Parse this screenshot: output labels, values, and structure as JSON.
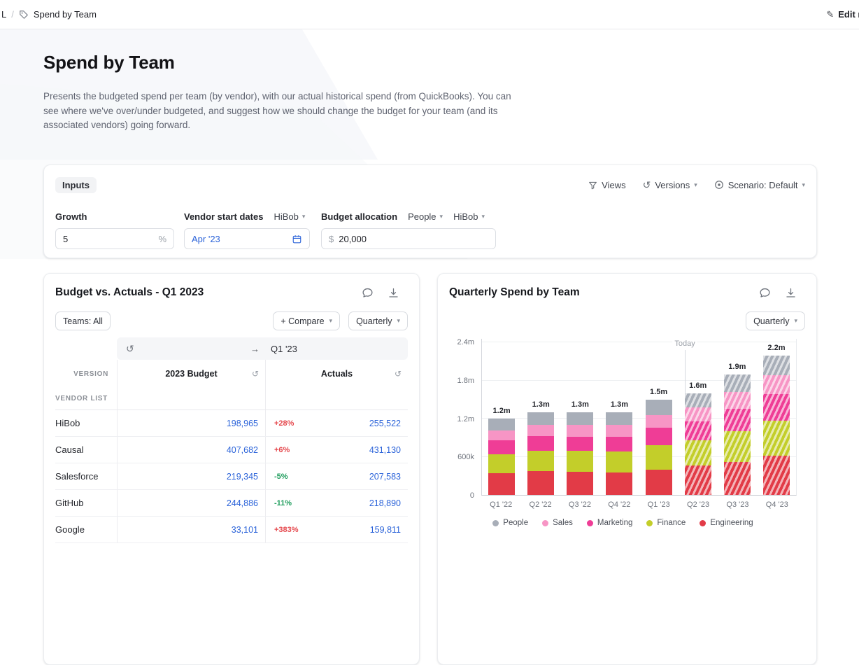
{
  "glyphs": {
    "caret": "▾",
    "history": "↺",
    "pencil": "✎"
  },
  "colors": {
    "accent_blue": "#2b63d9",
    "delta_up": "#e5484d",
    "delta_down": "#1f9d5d"
  },
  "topbar": {
    "crumb_truncated": "L",
    "separator": "/",
    "page_crumb": "Spend by Team",
    "edit_label": "Edit m"
  },
  "header": {
    "title": "Spend by Team",
    "description": "Presents the budgeted spend per team (by vendor), with our actual historical spend (from QuickBooks). You can see where we've over/under budgeted, and suggest how we should change the budget for your team (and its associated vendors) going forward."
  },
  "inputs_card": {
    "tab_label": "Inputs",
    "toolbar": {
      "views": "Views",
      "versions": "Versions",
      "scenario": "Scenario: Default"
    },
    "growth": {
      "label": "Growth",
      "value": "5",
      "suffix": "%"
    },
    "vendor_start_dates": {
      "label": "Vendor start dates",
      "selector": "HiBob",
      "value": "Apr '23"
    },
    "budget_allocation": {
      "label": "Budget allocation",
      "selector_team": "People",
      "selector_vendor": "HiBob",
      "prefix": "$",
      "value": "20,000"
    }
  },
  "left_card": {
    "title": "Budget vs. Actuals - Q1 2023",
    "teams_filter": "Teams: All",
    "compare_label": "+ Compare",
    "period_label": "Quarterly",
    "table": {
      "period_nav": {
        "arrow": "→",
        "period": "Q1 '23"
      },
      "version_label": "VERSION",
      "col_budget": "2023 Budget",
      "col_actuals": "Actuals",
      "group_label": "VENDOR LIST",
      "rows": [
        {
          "vendor": "HiBob",
          "budget": "198,965",
          "delta": "+28%",
          "actuals": "255,522"
        },
        {
          "vendor": "Causal",
          "budget": "407,682",
          "delta": "+6%",
          "actuals": "431,130"
        },
        {
          "vendor": "Salesforce",
          "budget": "219,345",
          "delta": "-5%",
          "actuals": "207,583"
        },
        {
          "vendor": "GitHub",
          "budget": "244,886",
          "delta": "-11%",
          "actuals": "218,890"
        },
        {
          "vendor": "Google",
          "budget": "33,101",
          "delta": "+383%",
          "actuals": "159,811"
        }
      ]
    }
  },
  "right_card": {
    "title": "Quarterly Spend by Team",
    "period_label": "Quarterly"
  },
  "chart_data": {
    "type": "bar",
    "stacked": true,
    "title": "Quarterly Spend by Team",
    "categories": [
      "Q1 '22",
      "Q2 '22",
      "Q3 '22",
      "Q4 '22",
      "Q1 '23",
      "Q2 '23",
      "Q3 '23",
      "Q4 '23"
    ],
    "series": [
      {
        "name": "Engineering",
        "color": "#e23b47",
        "values": [
          340000,
          370000,
          360000,
          350000,
          400000,
          460000,
          520000,
          620000
        ]
      },
      {
        "name": "Finance",
        "color": "#c3ce2a",
        "values": [
          300000,
          320000,
          330000,
          330000,
          380000,
          400000,
          480000,
          550000
        ]
      },
      {
        "name": "Marketing",
        "color": "#ef3d96",
        "values": [
          220000,
          240000,
          230000,
          240000,
          280000,
          300000,
          360000,
          420000
        ]
      },
      {
        "name": "Sales",
        "color": "#f795c5",
        "values": [
          160000,
          170000,
          180000,
          180000,
          200000,
          220000,
          260000,
          300000
        ]
      },
      {
        "name": "People",
        "color": "#a8aeb8",
        "values": [
          180000,
          200000,
          200000,
          200000,
          240000,
          220000,
          280000,
          310000
        ]
      }
    ],
    "totals_labels": [
      "1.2m",
      "1.3m",
      "1.3m",
      "1.3m",
      "1.5m",
      "1.6m",
      "1.9m",
      "2.2m"
    ],
    "yticks": [
      {
        "label": "0",
        "value": 0
      },
      {
        "label": "600k",
        "value": 600000
      },
      {
        "label": "1.2m",
        "value": 1200000
      },
      {
        "label": "1.8m",
        "value": 1800000
      },
      {
        "label": "2.4m",
        "value": 2400000
      }
    ],
    "ymax": 2460000,
    "forecast_start_index": 5,
    "today": {
      "label": "Today",
      "boundary_index": 5
    },
    "legend_position": "bottom"
  }
}
